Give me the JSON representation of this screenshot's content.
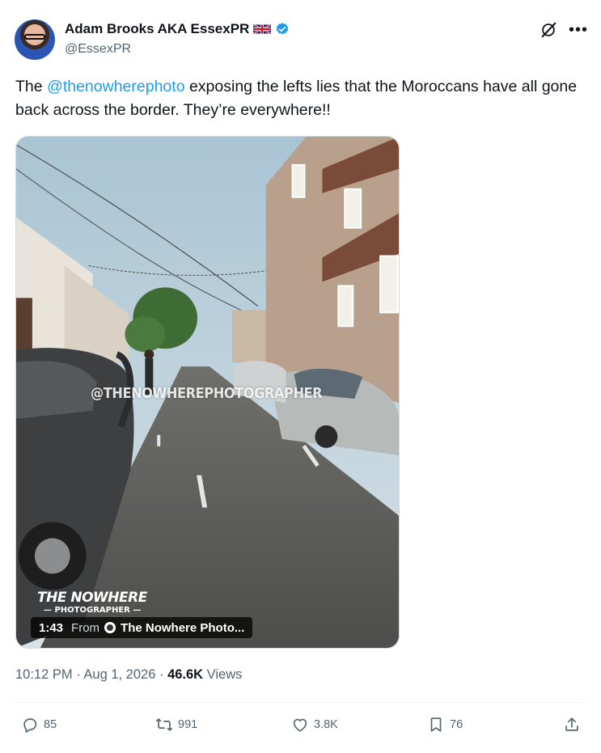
{
  "author": {
    "display_name": "Adam Brooks AKA EssexPR",
    "handle": "@EssexPR",
    "flag_icon": "uk-flag-icon",
    "verified_icon": "verified-badge-icon"
  },
  "tweet": {
    "text_prefix": "The ",
    "mention": "@thenowherephoto",
    "text_suffix": " exposing the lefts lies that the Moroccans have all gone back across the border.  They’re everywhere!!"
  },
  "media": {
    "watermark": "@THENOWHEREPHOTOGRAPHER",
    "brand_line1": "THE NOWHERE",
    "brand_line2": "— PHOTOGRAPHER —",
    "duration": "1:43",
    "from_label": "From",
    "source": "The Nowhere Photo..."
  },
  "meta": {
    "time": "10:12 PM",
    "sep1": " · ",
    "date": "Aug 1, 2026",
    "sep2": " · ",
    "views_count": "46.6K",
    "views_label": " Views"
  },
  "actions": {
    "replies": "85",
    "reposts": "991",
    "likes": "3.8K",
    "bookmarks": "76"
  },
  "colors": {
    "accent": "#1d9bf0",
    "text": "#0f1419",
    "secondary": "#536471"
  }
}
